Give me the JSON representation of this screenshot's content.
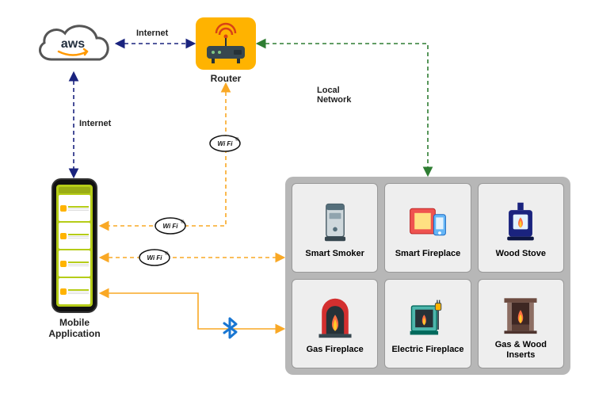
{
  "nodes": {
    "aws": {
      "label": "aws"
    },
    "router": {
      "label": "Router"
    },
    "phone": {
      "label": "Mobile\nApplication"
    },
    "devices_group": {
      "label": ""
    }
  },
  "devices": [
    {
      "id": "smart-smoker",
      "label": "Smart Smoker"
    },
    {
      "id": "smart-fireplace",
      "label": "Smart Fireplace"
    },
    {
      "id": "wood-stove",
      "label": "Wood Stove"
    },
    {
      "id": "gas-fireplace",
      "label": "Gas Fireplace"
    },
    {
      "id": "electric-fireplace",
      "label": "Electric Fireplace"
    },
    {
      "id": "gas-wood-inserts",
      "label": "Gas & Wood Inserts"
    }
  ],
  "edges": {
    "aws_router": {
      "label": "Internet",
      "style": "dashed",
      "color": "#1a237e"
    },
    "aws_phone": {
      "label": "Internet",
      "style": "dashed",
      "color": "#1a237e"
    },
    "router_devices": {
      "label": "Local\nNetwork",
      "style": "dashed",
      "color": "#2e7d32"
    },
    "router_phone_wifi": {
      "label": "WiFi",
      "style": "dashed",
      "color": "#f9a825"
    },
    "phone_devices_wifi1": {
      "label": "WiFi",
      "style": "dashed",
      "color": "#f9a825"
    },
    "phone_devices_wifi2": {
      "label": "WiFi",
      "style": "dashed",
      "color": "#f9a825"
    },
    "phone_devices_bt": {
      "label": "Bluetooth",
      "style": "solid",
      "color": "#f9a825"
    }
  },
  "badges": {
    "wifi": "WiFi",
    "bt": "Bluetooth"
  },
  "colors": {
    "router": "#ffb300",
    "phoneAccent": "#b5cc18",
    "devicesCard": "#b7b7b7",
    "deviceCell": "#eeeeee"
  }
}
